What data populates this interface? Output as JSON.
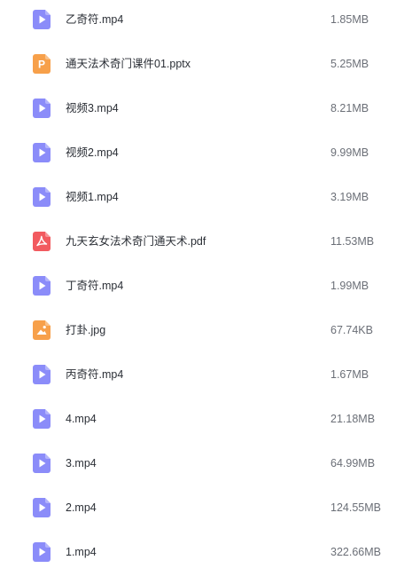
{
  "files": [
    {
      "name": "乙奇符.mp4",
      "size": "1.85MB",
      "type": "video",
      "icon": "video-file-icon",
      "color": "#8b8cf9"
    },
    {
      "name": "通天法术奇门课件01.pptx",
      "size": "5.25MB",
      "type": "ppt",
      "icon": "ppt-file-icon",
      "color": "#f7a04a"
    },
    {
      "name": "视频3.mp4",
      "size": "8.21MB",
      "type": "video",
      "icon": "video-file-icon",
      "color": "#8b8cf9"
    },
    {
      "name": "视频2.mp4",
      "size": "9.99MB",
      "type": "video",
      "icon": "video-file-icon",
      "color": "#8b8cf9"
    },
    {
      "name": "视频1.mp4",
      "size": "3.19MB",
      "type": "video",
      "icon": "video-file-icon",
      "color": "#8b8cf9"
    },
    {
      "name": "九天玄女法术奇门通天术.pdf",
      "size": "11.53MB",
      "type": "pdf",
      "icon": "pdf-file-icon",
      "color": "#f25a5f"
    },
    {
      "name": "丁奇符.mp4",
      "size": "1.99MB",
      "type": "video",
      "icon": "video-file-icon",
      "color": "#8b8cf9"
    },
    {
      "name": "打卦.jpg",
      "size": "67.74KB",
      "type": "image",
      "icon": "image-file-icon",
      "color": "#f7a04a"
    },
    {
      "name": "丙奇符.mp4",
      "size": "1.67MB",
      "type": "video",
      "icon": "video-file-icon",
      "color": "#8b8cf9"
    },
    {
      "name": "4.mp4",
      "size": "21.18MB",
      "type": "video",
      "icon": "video-file-icon",
      "color": "#8b8cf9"
    },
    {
      "name": "3.mp4",
      "size": "64.99MB",
      "type": "video",
      "icon": "video-file-icon",
      "color": "#8b8cf9"
    },
    {
      "name": "2.mp4",
      "size": "124.55MB",
      "type": "video",
      "icon": "video-file-icon",
      "color": "#8b8cf9"
    },
    {
      "name": "1.mp4",
      "size": "322.66MB",
      "type": "video",
      "icon": "video-file-icon",
      "color": "#8b8cf9"
    }
  ]
}
